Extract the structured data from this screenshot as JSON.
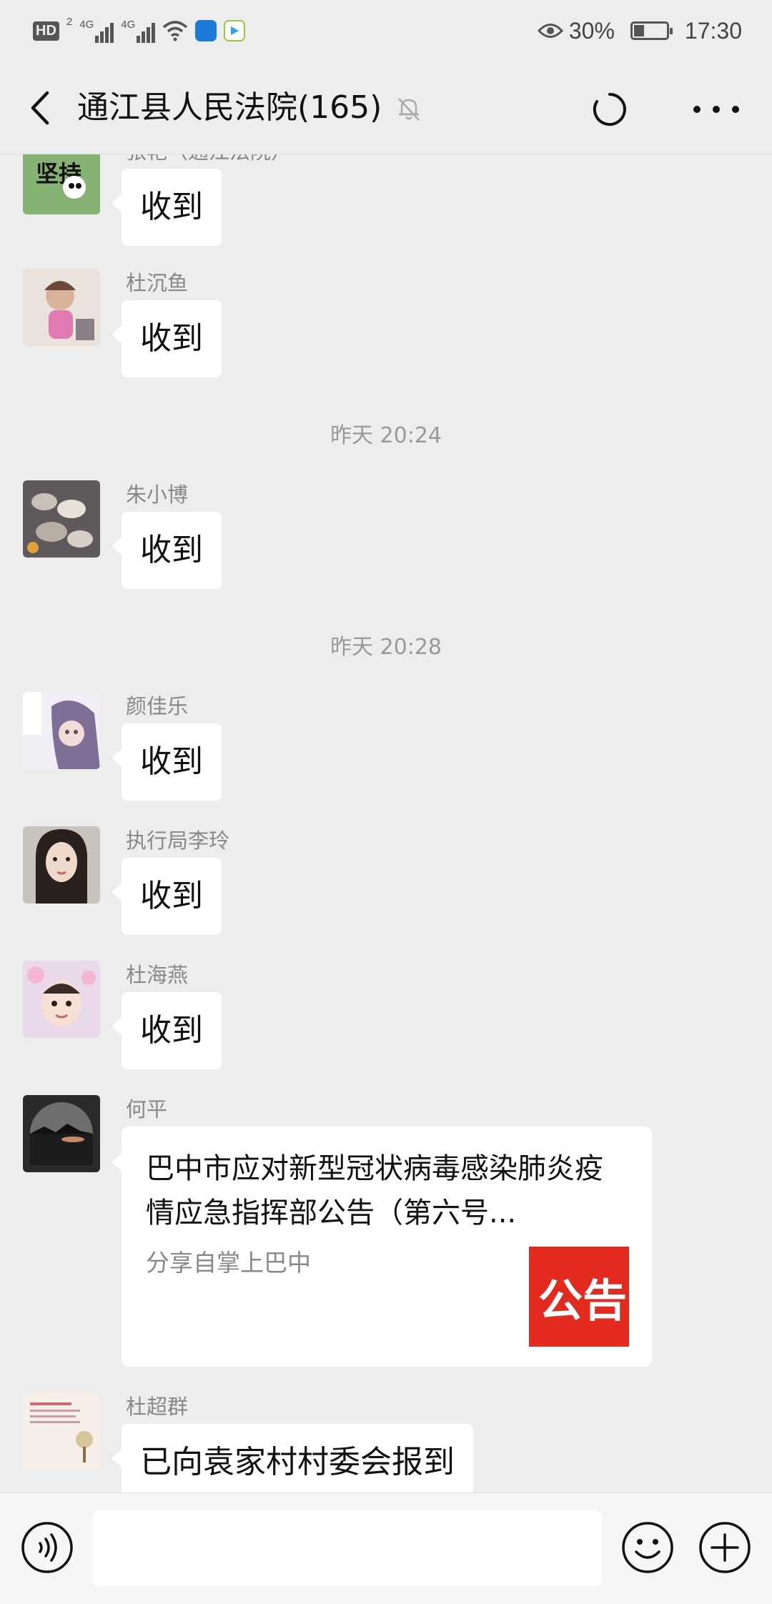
{
  "status_bar": {
    "network_1": "4G",
    "network_2": "4G",
    "sim_tag": "2",
    "hd_label": "HD",
    "battery": "30%",
    "time": "17:30"
  },
  "nav": {
    "title": "通江县人民法院(165)"
  },
  "messages": [
    {
      "sender": "张艳（通江法院）",
      "text": "收到"
    },
    {
      "sender": "杜沉鱼",
      "text": "收到"
    },
    {
      "sender": "朱小博",
      "text": "收到"
    },
    {
      "sender": "颜佳乐",
      "text": "收到"
    },
    {
      "sender": "执行局李玲",
      "text": "收到"
    },
    {
      "sender": "杜海燕",
      "text": "收到"
    },
    {
      "sender": "何平",
      "card_title": "巴中市应对新型冠状病毒感染肺炎疫情应急指挥部公告（第六号...",
      "card_source": "分享自掌上巴中",
      "card_thumb_text": "公告"
    },
    {
      "sender": "杜超群",
      "text": "已向袁家村村委会报到"
    }
  ],
  "timestamps": [
    "昨天 20:24",
    "昨天 20:28"
  ],
  "input": {
    "placeholder": ""
  }
}
